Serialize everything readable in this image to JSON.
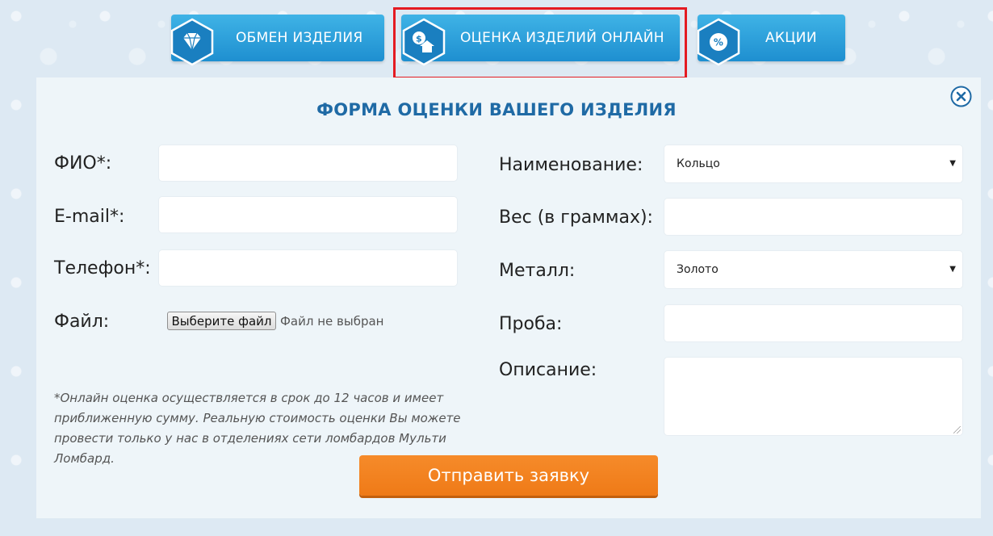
{
  "nav": {
    "exchange": {
      "label": "ОБМЕН ИЗДЕЛИЯ",
      "icon": "diamond-icon"
    },
    "online_appraisal": {
      "label": "ОЦЕНКА ИЗДЕЛИЙ ОНЛАЙН",
      "icon": "money-house-icon"
    },
    "promotions": {
      "label": "АКЦИИ",
      "icon": "percent-icon"
    }
  },
  "form": {
    "title": "ФОРМА ОЦЕНКИ ВАШЕГО ИЗДЕЛИЯ",
    "left": {
      "fio_label": "ФИО*:",
      "fio_value": "",
      "email_label": "E-mail*:",
      "email_value": "",
      "phone_label": "Телефон*:",
      "phone_value": "",
      "file_label": "Файл:",
      "file_button": "Выберите файл",
      "file_status": "Файл не выбран"
    },
    "right": {
      "name_label": "Наименование:",
      "name_selected": "Кольцо",
      "weight_label": "Вес (в граммах):",
      "weight_value": "",
      "metal_label": "Металл:",
      "metal_selected": "Золото",
      "probe_label": "Проба:",
      "probe_value": "",
      "description_label": "Описание:",
      "description_value": ""
    },
    "note": "*Онлайн оценка осуществляется в срок до 12 часов и имеет приближенную сумму. Реальную стоимость оценки Вы можете провести только у нас в отделениях сети ломбардов Мульти Ломбард.",
    "submit_label": "Отправить заявку"
  },
  "colors": {
    "nav_blue": "#2a9fdc",
    "title_blue": "#1f6aa5",
    "submit_orange": "#f07f1e",
    "highlight_red": "#e41b22"
  }
}
